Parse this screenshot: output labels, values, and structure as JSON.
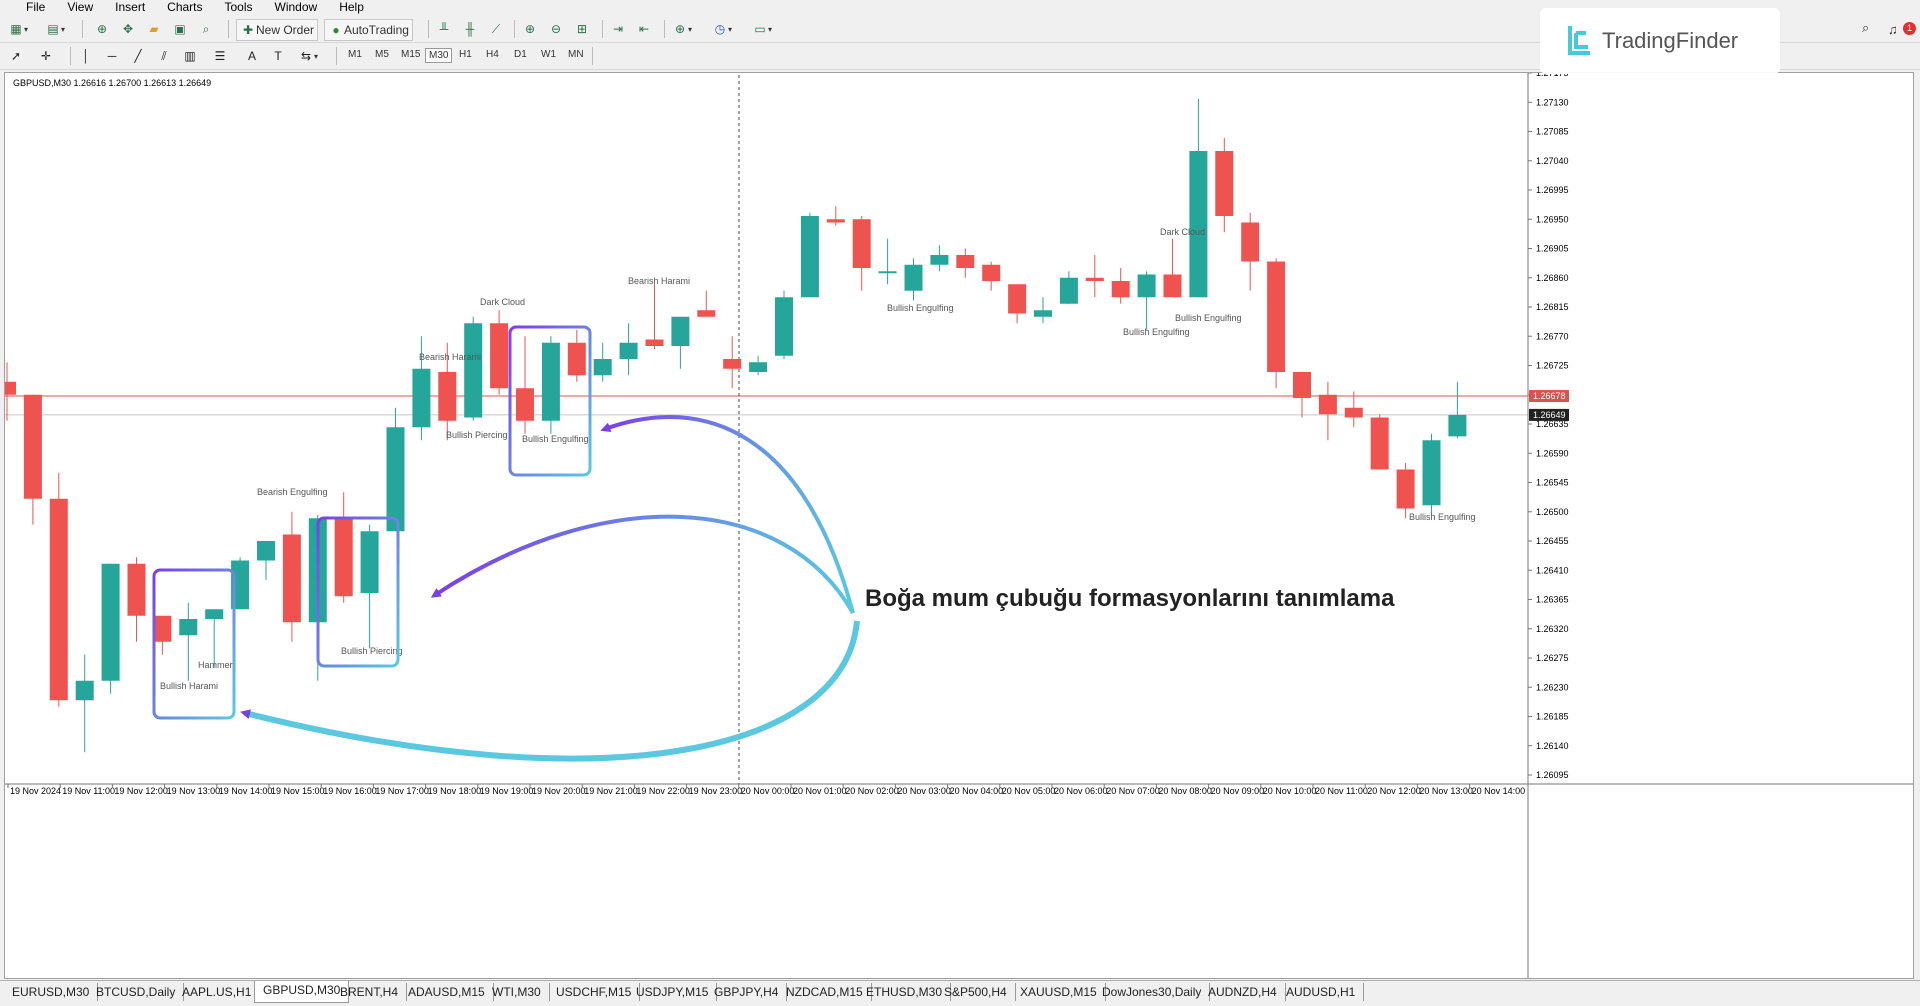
{
  "menu": [
    "File",
    "View",
    "Insert",
    "Charts",
    "Tools",
    "Window",
    "Help"
  ],
  "toolbar": {
    "new_order_label": "New Order",
    "autotrading_label": "AutoTrading",
    "timeframes": [
      "M1",
      "M5",
      "M15",
      "M30",
      "H1",
      "H4",
      "D1",
      "W1",
      "MN"
    ],
    "active_timeframe": "M30"
  },
  "chart_header": "GBPUSD,M30  1.26616 1.26700 1.26613 1.26649",
  "y_axis_labels": [
    "1.27175",
    "1.27130",
    "1.27085",
    "1.27040",
    "1.26995",
    "1.26950",
    "1.26905",
    "1.26860",
    "1.26815",
    "1.26770",
    "1.26725",
    "1.26680",
    "1.26635",
    "1.26590",
    "1.26545",
    "1.26500",
    "1.26455",
    "1.26410",
    "1.26365",
    "1.26320",
    "1.26275",
    "1.26230",
    "1.26185",
    "1.26140",
    "1.26095"
  ],
  "price_tags": {
    "ask": "1.26678",
    "bid": "1.26649"
  },
  "x_axis_labels": [
    "19 Nov 2024",
    "19 Nov 11:00",
    "19 Nov 12:00",
    "19 Nov 13:00",
    "19 Nov 14:00",
    "19 Nov 15:00",
    "19 Nov 16:00",
    "19 Nov 17:00",
    "19 Nov 18:00",
    "19 Nov 19:00",
    "19 Nov 20:00",
    "19 Nov 21:00",
    "19 Nov 22:00",
    "19 Nov 23:00",
    "20 Nov 00:00",
    "20 Nov 01:00",
    "20 Nov 02:00",
    "20 Nov 03:00",
    "20 Nov 04:00",
    "20 Nov 05:00",
    "20 Nov 06:00",
    "20 Nov 07:00",
    "20 Nov 08:00",
    "20 Nov 09:00",
    "20 Nov 10:00",
    "20 Nov 11:00",
    "20 Nov 12:00",
    "20 Nov 13:00",
    "20 Nov 14:00"
  ],
  "pattern_labels": [
    {
      "text": "Bullish Harami",
      "id": "lbl-bullish-harami"
    },
    {
      "text": "Hammer",
      "id": "lbl-hammer"
    },
    {
      "text": "Bearish Engulfing",
      "id": "lbl-bearish-engulfing-1"
    },
    {
      "text": "Bullish Piercing",
      "id": "lbl-bullish-piercing-1"
    },
    {
      "text": "Bearish Harami",
      "id": "lbl-bearish-harami-1"
    },
    {
      "text": "Bullish Piercing",
      "id": "lbl-bullish-piercing-2"
    },
    {
      "text": "Dark Cloud",
      "id": "lbl-dark-cloud-1"
    },
    {
      "text": "Bullish Engulfing",
      "id": "lbl-bullish-engulfing-1"
    },
    {
      "text": "Bearish Harami",
      "id": "lbl-bearish-harami-2"
    },
    {
      "text": "Bullish Engulfing",
      "id": "lbl-bullish-engulfing-2"
    },
    {
      "text": "Dark Cloud",
      "id": "lbl-dark-cloud-2"
    },
    {
      "text": "Bullish Engulfing",
      "id": "lbl-bullish-engulfing-3"
    },
    {
      "text": "Bullish Engulfing",
      "id": "lbl-bullish-engulfing-4"
    },
    {
      "text": "Bullish Engulfing",
      "id": "lbl-bullish-engulfing-5"
    }
  ],
  "annotation": "Boğa mum çubuğu formasyonlarını tanımlama",
  "logo_text": "TradingFinder",
  "notification_count": "1",
  "tabs": [
    "EURUSD,M30",
    "BTCUSD,Daily",
    "AAPL.US,H1",
    "GBPUSD,M30",
    "BRENT,H4",
    "ADAUSD,M15",
    "WTI,M30",
    "USDCHF,M15",
    "USDJPY,M15",
    "GBPJPY,H4",
    "NZDCAD,M15",
    "ETHUSD,M30",
    "S&P500,H4",
    "XAUUSD,M15",
    "DowJones30,Daily",
    "AUDNZD,H4",
    "AUDUSD,H1"
  ],
  "active_tab": "GBPUSD,M30",
  "colors": {
    "bull": "#26a69a",
    "bear": "#ef5350",
    "box_start": "#7b3fe4",
    "box_end": "#5bc8e0"
  },
  "icons": [
    "new-chart-icon",
    "profiles-icon",
    "zoom-in-icon",
    "zoom-out-icon",
    "crosshair-icon",
    "cursor-icon",
    "line-icon",
    "text-icon",
    "search-icon",
    "bell-icon"
  ],
  "chart_data": {
    "type": "candlestick",
    "symbol": "GBPUSD",
    "timeframe": "M30",
    "ylim": [
      1.26095,
      1.27175
    ],
    "candles": [
      {
        "o": 1.267,
        "h": 1.2673,
        "l": 1.2664,
        "c": 1.2668
      },
      {
        "o": 1.2668,
        "h": 1.2668,
        "l": 1.2648,
        "c": 1.2652
      },
      {
        "o": 1.2652,
        "h": 1.2656,
        "l": 1.262,
        "c": 1.2621
      },
      {
        "o": 1.2621,
        "h": 1.2628,
        "l": 1.2613,
        "c": 1.2624
      },
      {
        "o": 1.2624,
        "h": 1.2642,
        "l": 1.2622,
        "c": 1.2642
      },
      {
        "o": 1.2642,
        "h": 1.2643,
        "l": 1.263,
        "c": 1.2634
      },
      {
        "o": 1.2634,
        "h": 1.2634,
        "l": 1.2628,
        "c": 1.263
      },
      {
        "o": 1.2631,
        "h": 1.2636,
        "l": 1.2624,
        "c": 1.26335
      },
      {
        "o": 1.26335,
        "h": 1.2635,
        "l": 1.2626,
        "c": 1.2635
      },
      {
        "o": 1.2635,
        "h": 1.2643,
        "l": 1.2635,
        "c": 1.26425
      },
      {
        "o": 1.26425,
        "h": 1.26445,
        "l": 1.26395,
        "c": 1.26455
      },
      {
        "o": 1.26465,
        "h": 1.265,
        "l": 1.263,
        "c": 1.2633
      },
      {
        "o": 1.2633,
        "h": 1.26495,
        "l": 1.2624,
        "c": 1.2649
      },
      {
        "o": 1.2649,
        "h": 1.2653,
        "l": 1.2636,
        "c": 1.2637
      },
      {
        "o": 1.26375,
        "h": 1.2648,
        "l": 1.2629,
        "c": 1.2647
      },
      {
        "o": 1.2647,
        "h": 1.2666,
        "l": 1.2647,
        "c": 1.2663
      },
      {
        "o": 1.2663,
        "h": 1.2677,
        "l": 1.2661,
        "c": 1.2672
      },
      {
        "o": 1.26715,
        "h": 1.2676,
        "l": 1.2661,
        "c": 1.2664
      },
      {
        "o": 1.26645,
        "h": 1.268,
        "l": 1.2664,
        "c": 1.2679
      },
      {
        "o": 1.2679,
        "h": 1.2681,
        "l": 1.2668,
        "c": 1.2669
      },
      {
        "o": 1.2669,
        "h": 1.2677,
        "l": 1.2662,
        "c": 1.2664
      },
      {
        "o": 1.2664,
        "h": 1.2677,
        "l": 1.2662,
        "c": 1.2676
      },
      {
        "o": 1.2676,
        "h": 1.2678,
        "l": 1.267,
        "c": 1.2671
      },
      {
        "o": 1.2671,
        "h": 1.2676,
        "l": 1.267,
        "c": 1.26735
      },
      {
        "o": 1.26735,
        "h": 1.2679,
        "l": 1.2671,
        "c": 1.2676
      },
      {
        "o": 1.26765,
        "h": 1.2685,
        "l": 1.2675,
        "c": 1.26755
      },
      {
        "o": 1.26755,
        "h": 1.268,
        "l": 1.2672,
        "c": 1.268
      },
      {
        "o": 1.2681,
        "h": 1.2684,
        "l": 1.268,
        "c": 1.268
      },
      {
        "o": 1.26735,
        "h": 1.2677,
        "l": 1.2669,
        "c": 1.2672
      },
      {
        "o": 1.26715,
        "h": 1.2674,
        "l": 1.2671,
        "c": 1.2673
      },
      {
        "o": 1.2674,
        "h": 1.2684,
        "l": 1.26735,
        "c": 1.2683
      },
      {
        "o": 1.2683,
        "h": 1.2696,
        "l": 1.2683,
        "c": 1.26955
      },
      {
        "o": 1.2695,
        "h": 1.2697,
        "l": 1.2694,
        "c": 1.26945
      },
      {
        "o": 1.2695,
        "h": 1.26955,
        "l": 1.2684,
        "c": 1.26875
      },
      {
        "o": 1.2687,
        "h": 1.2692,
        "l": 1.2685,
        "c": 1.2687
      },
      {
        "o": 1.2684,
        "h": 1.2689,
        "l": 1.26825,
        "c": 1.2688
      },
      {
        "o": 1.2688,
        "h": 1.2691,
        "l": 1.2687,
        "c": 1.26895
      },
      {
        "o": 1.26895,
        "h": 1.26905,
        "l": 1.2686,
        "c": 1.26875
      },
      {
        "o": 1.2688,
        "h": 1.26885,
        "l": 1.2684,
        "c": 1.26855
      },
      {
        "o": 1.2685,
        "h": 1.2685,
        "l": 1.2679,
        "c": 1.26805
      },
      {
        "o": 1.268,
        "h": 1.2683,
        "l": 1.2679,
        "c": 1.2681
      },
      {
        "o": 1.2682,
        "h": 1.2687,
        "l": 1.2682,
        "c": 1.2686
      },
      {
        "o": 1.2686,
        "h": 1.26895,
        "l": 1.2683,
        "c": 1.26855
      },
      {
        "o": 1.26855,
        "h": 1.26875,
        "l": 1.2682,
        "c": 1.2683
      },
      {
        "o": 1.2683,
        "h": 1.2687,
        "l": 1.2678,
        "c": 1.26865
      },
      {
        "o": 1.26865,
        "h": 1.2692,
        "l": 1.2683,
        "c": 1.2683
      },
      {
        "o": 1.2683,
        "h": 1.27135,
        "l": 1.2683,
        "c": 1.27055
      },
      {
        "o": 1.27055,
        "h": 1.27075,
        "l": 1.2693,
        "c": 1.26955
      },
      {
        "o": 1.26945,
        "h": 1.2696,
        "l": 1.2684,
        "c": 1.26885
      },
      {
        "o": 1.26885,
        "h": 1.2689,
        "l": 1.2669,
        "c": 1.26715
      },
      {
        "o": 1.26715,
        "h": 1.26715,
        "l": 1.26645,
        "c": 1.26675
      },
      {
        "o": 1.2668,
        "h": 1.267,
        "l": 1.2661,
        "c": 1.2665
      },
      {
        "o": 1.2666,
        "h": 1.26685,
        "l": 1.2663,
        "c": 1.26645
      },
      {
        "o": 1.26645,
        "h": 1.2665,
        "l": 1.26565,
        "c": 1.26565
      },
      {
        "o": 1.26565,
        "h": 1.26575,
        "l": 1.2649,
        "c": 1.26505
      },
      {
        "o": 1.2651,
        "h": 1.2662,
        "l": 1.26495,
        "c": 1.2661
      },
      {
        "o": 1.26616,
        "h": 1.267,
        "l": 1.26613,
        "c": 1.26649
      }
    ]
  }
}
